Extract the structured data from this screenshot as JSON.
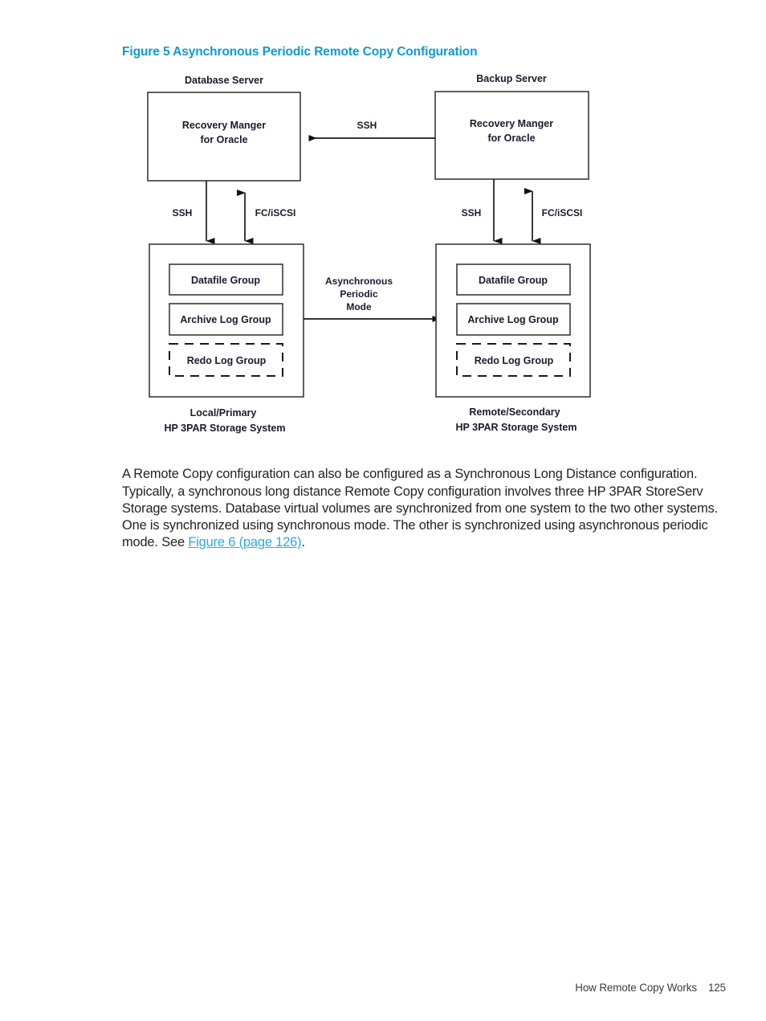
{
  "figure": {
    "caption": "Figure 5 Asynchronous Periodic Remote Copy Configuration",
    "caption_color": "#0b9bd8"
  },
  "diagram": {
    "servers": {
      "left": {
        "header": "Database Server",
        "box_line1": "Recovery Manger",
        "box_line2": "for Oracle"
      },
      "right": {
        "header": "Backup Server",
        "box_line1": "Recovery Manger",
        "box_line2": "for Oracle"
      }
    },
    "connectors": {
      "server_to_server": "SSH",
      "left_ssh": "SSH",
      "left_fc": "FC/iSCSI",
      "right_ssh": "SSH",
      "right_fc": "FC/iSCSI",
      "replication_line1": "Asynchronous",
      "replication_line2": "Periodic",
      "replication_line3": "Mode"
    },
    "storage": {
      "left": {
        "groups": [
          "Datafile Group",
          "Archive Log Group",
          "Redo Log Group"
        ],
        "footer_line1": "Local/Primary",
        "footer_line2": "HP 3PAR Storage System"
      },
      "right": {
        "groups": [
          "Datafile Group",
          "Archive Log Group",
          "Redo Log Group"
        ],
        "footer_line1": "Remote/Secondary",
        "footer_line2": "HP 3PAR Storage System"
      }
    }
  },
  "body": {
    "text_before_link": "A Remote Copy configuration can also be configured as a Synchronous Long Distance configuration. Typically, a synchronous long distance Remote Copy configuration involves three HP 3PAR StoreServ Storage systems. Database virtual volumes are synchronized from one system to the two other systems. One is synchronized using synchronous mode. The other is synchronized using asynchronous periodic mode. See ",
    "link_text": "Figure 6 (page 126)",
    "text_after_link": "."
  },
  "footer": {
    "section_title": "How Remote Copy Works",
    "page_number": "125"
  }
}
